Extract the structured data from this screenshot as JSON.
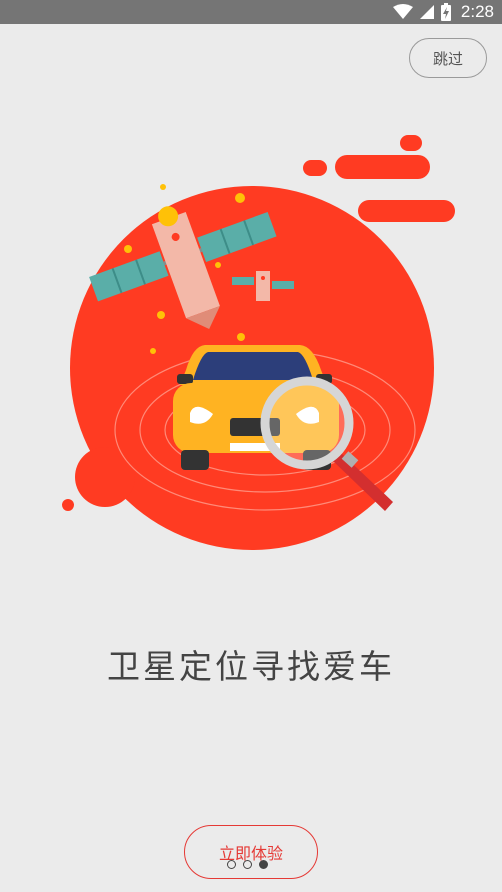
{
  "status_bar": {
    "time": "2:28",
    "icons": [
      "wifi-icon",
      "cellular-signal-icon",
      "battery-charging-icon"
    ]
  },
  "skip_button": {
    "label": "跳过"
  },
  "illustration": {
    "icons": [
      "satellite-icon",
      "car-icon",
      "magnifier-icon"
    ],
    "colors": {
      "circle": "#ff3b22",
      "car": "#ffb322",
      "panel": "#5aaea8"
    }
  },
  "headline": "卫星定位寻找爱车",
  "start_button": {
    "label": "立即体验"
  },
  "pager": {
    "page_count": 3,
    "active_page": 3
  },
  "colors": {
    "background": "#ebebeb",
    "accent": "#e53935",
    "status_bar": "#757575"
  }
}
